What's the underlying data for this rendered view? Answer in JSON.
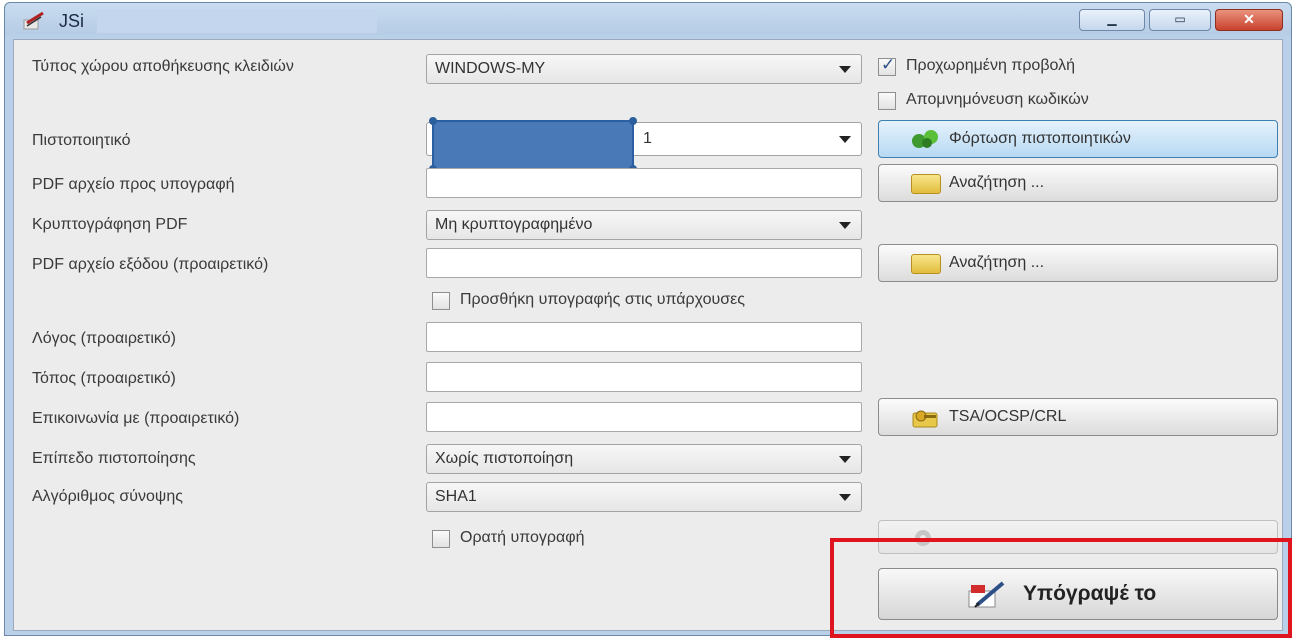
{
  "window": {
    "title": "JSi"
  },
  "form": {
    "keystore_type_label": "Τύπος χώρου αποθήκευσης κλειδιών",
    "keystore_type_value": "WINDOWS-MY",
    "advanced_view_label": "Προχωρημένη προβολή",
    "advanced_view_checked": true,
    "remember_passwords_label": "Απομνημόνευση κωδικών",
    "remember_passwords_checked": false,
    "certificate_label": "Πιστοποιητικό",
    "certificate_value": "1",
    "load_certificates_label": "Φόρτωση πιστοποιητικών",
    "pdf_input_label": "PDF αρχείο προς υπογραφή",
    "pdf_input_value": "",
    "browse_label": "Αναζήτηση ...",
    "encryption_label": "Κρυπτογράφηση PDF",
    "encryption_value": "Μη κρυπτογραφημένο",
    "pdf_output_label": "PDF αρχείο εξόδου (προαιρετικό)",
    "pdf_output_value": "",
    "browse_output_label": "Αναζήτηση ...",
    "append_signature_label": "Προσθήκη υπογραφής στις υπάρχουσες",
    "append_signature_checked": false,
    "reason_label": "Λόγος (προαιρετικό)",
    "reason_value": "",
    "location_label": "Τόπος (προαιρετικό)",
    "location_value": "",
    "contact_label": "Επικοινωνία με (προαιρετικό)",
    "contact_value": "",
    "tsa_label": "TSA/OCSP/CRL",
    "cert_level_label": "Επίπεδο πιστοποίησης",
    "cert_level_value": "Χωρίς πιστοποίηση",
    "hash_label": "Αλγόριθμος σύνοψης",
    "hash_value": "SHA1",
    "visible_signature_label": "Ορατή υπογραφή",
    "visible_signature_checked": false,
    "sign_button_label": "Υπόγραψέ το"
  },
  "colors": {
    "highlight": "#e0141f",
    "window_frame": "#b9d0e8",
    "close_button": "#c8412c",
    "redaction_block": "#4a79b8"
  },
  "icons": {
    "app": "pen-signature-icon",
    "load": "certificate-green-icon",
    "browse": "folder-icon",
    "tsa": "key-folder-icon",
    "sign": "pen-signature-icon"
  }
}
